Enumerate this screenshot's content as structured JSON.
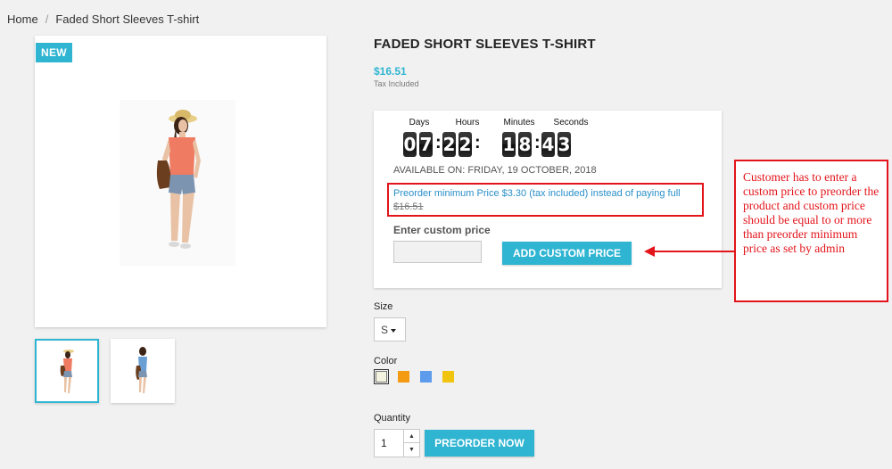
{
  "breadcrumb": {
    "home": "Home",
    "separator": "/",
    "current": "Faded Short Sleeves T-shirt"
  },
  "product": {
    "badge": "NEW",
    "title": "Faded Short Sleeves T-shirt",
    "price": "$16.51",
    "tax_note": "Tax Included"
  },
  "countdown": {
    "labels": [
      "Days",
      "Hours",
      "Minutes",
      "Seconds"
    ],
    "digits": [
      "0",
      "7",
      "2",
      "2",
      "1",
      "8",
      "4",
      "3"
    ],
    "separator": ":"
  },
  "preorder": {
    "available": "AVAILABLE ON: FRIDAY, 19 OCTOBER, 2018",
    "min_price_text": "Preorder minimum Price $3.30 (tax included) instead of paying full",
    "old_price": "$16.51",
    "custom_label": "Enter custom price",
    "custom_value": "",
    "add_button": "ADD CUSTOM PRICE"
  },
  "annotation": {
    "text": "Customer has to enter a custom price to preorder the product and custom price should be equal to or more than preorder minimum price as set by admin"
  },
  "variants": {
    "size_label": "Size",
    "size_value": "S",
    "color_label": "Color",
    "colors": [
      "#f3f3df",
      "#f39c11",
      "#5d9cec",
      "#f1c40f"
    ],
    "selected_color_index": 0
  },
  "quantity": {
    "label": "Quantity",
    "value": "1"
  },
  "actions": {
    "preorder_button": "PREORDER NOW"
  },
  "colors": {
    "accent": "#2fb5d2",
    "annotation_red": "#e3141b"
  }
}
